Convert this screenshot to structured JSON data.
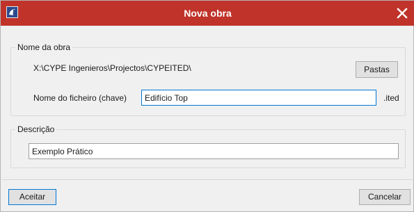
{
  "window": {
    "title": "Nova obra",
    "accent_color": "#c0332a",
    "icons": {
      "app": "cype-app-icon",
      "close": "close-icon"
    }
  },
  "project_name_group": {
    "legend": "Nome da obra",
    "path": "X:\\CYPE Ingenieros\\Projectos\\CYPEITED\\",
    "folders_button": "Pastas",
    "file_name_label": "Nome do ficheiro (chave)",
    "file_name_value": "Edifício Top",
    "extension": ".ited"
  },
  "description_group": {
    "legend": "Descrição",
    "value": "Exemplo Prático"
  },
  "footer": {
    "accept_button": "Aceitar",
    "cancel_button": "Cancelar"
  }
}
